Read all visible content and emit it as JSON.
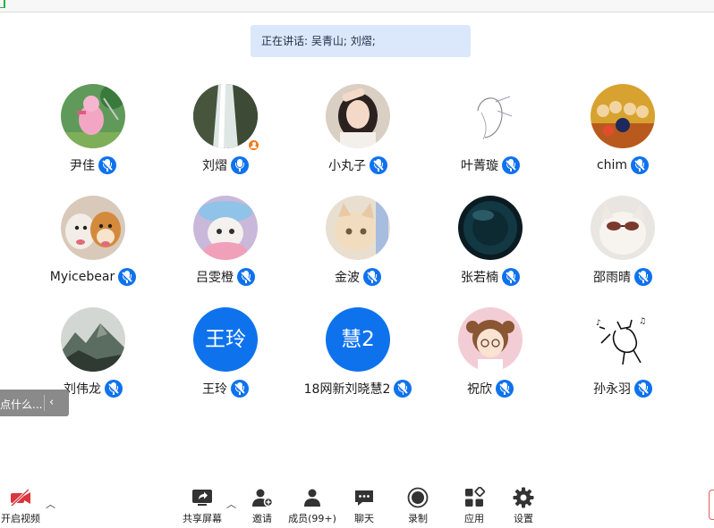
{
  "speaking_banner": "正在讲话: 吴青山; 刘熠;",
  "participants": [
    {
      "name": "尹佳",
      "avatar": "piglet-photo"
    },
    {
      "name": "刘熠",
      "avatar": "waterfall-photo",
      "host": true
    },
    {
      "name": "小丸子",
      "avatar": "girl-photo"
    },
    {
      "name": "叶菁璇",
      "avatar": "sketch-drawing"
    },
    {
      "name": "chim",
      "avatar": "cartoon-crowd"
    },
    {
      "name": "Myicebear",
      "avatar": "dogs-photo"
    },
    {
      "name": "吕雯橙",
      "avatar": "cat-hat-photo"
    },
    {
      "name": "金波",
      "avatar": "kitten-photo"
    },
    {
      "name": "张若楠",
      "avatar": "dark-sphere"
    },
    {
      "name": "邵雨晴",
      "avatar": "cat-sunglasses"
    },
    {
      "name": "刘伟龙",
      "avatar": "landscape-painting"
    },
    {
      "name": "王玲",
      "avatar": "initials",
      "initials": "王玲"
    },
    {
      "name": "18网新刘晓慧2",
      "avatar": "initials",
      "initials": "慧2"
    },
    {
      "name": "祝欣",
      "avatar": "cartoon-girl"
    },
    {
      "name": "孙永羽",
      "avatar": "doodle-cat"
    }
  ],
  "side_tab": {
    "text": "点什么..."
  },
  "toolbar": {
    "video_label": "开启视频",
    "share_label": "共享屏幕",
    "invite_label": "邀请",
    "members_label": "成员(99+)",
    "chat_label": "聊天",
    "record_label": "录制",
    "apps_label": "应用",
    "settings_label": "设置"
  },
  "colors": {
    "accent": "#0e72ed",
    "banner": "#dbe8fb",
    "host": "#f07a1c",
    "video_off": "#d9363e"
  }
}
